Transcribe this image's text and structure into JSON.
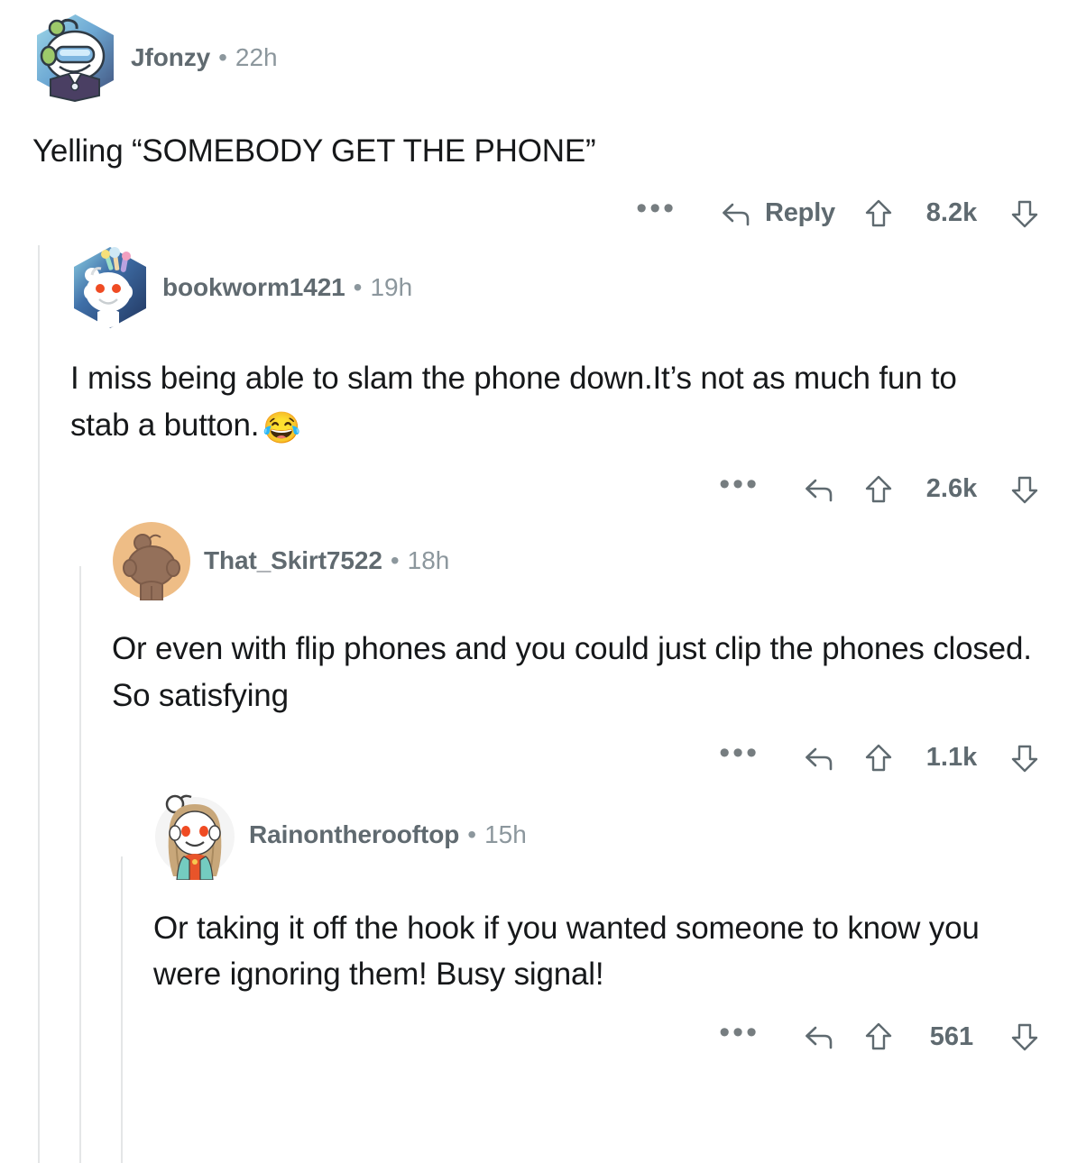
{
  "app": "reddit-comment-thread",
  "theme": {
    "background": "#ffffff",
    "text": "#16181a",
    "meta_text": "#8c979d",
    "username_text": "#606a70",
    "action_text": "#5f6a70",
    "threadline": "#e4e6e7"
  },
  "actions": {
    "more_label": "•••",
    "reply_label": "Reply",
    "upvote_icon": "upvote-arrow-icon",
    "downvote_icon": "downvote-arrow-icon",
    "reply_icon": "reply-arrow-icon",
    "more_icon": "overflow-menu-icon"
  },
  "comments": [
    {
      "id": "c0",
      "depth": 0,
      "username": "Jfonzy",
      "separator": "•",
      "timestamp": "22h",
      "avatar": "snoo-vr-goggles-blue-hex-avatar",
      "body": "Yelling “SOMEBODY GET THE PHONE”",
      "emoji": "",
      "score": "8.2k",
      "show_reply_label": true
    },
    {
      "id": "c1",
      "depth": 1,
      "username": "bookworm1421",
      "separator": "•",
      "timestamp": "19h",
      "avatar": "snoo-white-red-eyes-blue-hex-avatar",
      "body": "I miss being able to slam the phone down.It’s not as much fun to stab a button.",
      "emoji": "😂",
      "score": "2.6k",
      "show_reply_label": false
    },
    {
      "id": "c2",
      "depth": 2,
      "username": "That_Skirt7522",
      "separator": "•",
      "timestamp": "18h",
      "avatar": "snoo-brown-silhouette-tan-circle-avatar",
      "body": "Or even with flip phones and you could just clip the phones closed. So satisfying",
      "emoji": "",
      "score": "1.1k",
      "show_reply_label": false
    },
    {
      "id": "c3",
      "depth": 3,
      "username": "Rainontherooftop",
      "separator": "•",
      "timestamp": "15h",
      "avatar": "snoo-long-hair-teal-jacket-avatar",
      "body": "Or taking it off the hook if you wanted someone to know you were ignoring them!  Busy signal!",
      "emoji": "",
      "score": "561",
      "show_reply_label": false
    }
  ]
}
